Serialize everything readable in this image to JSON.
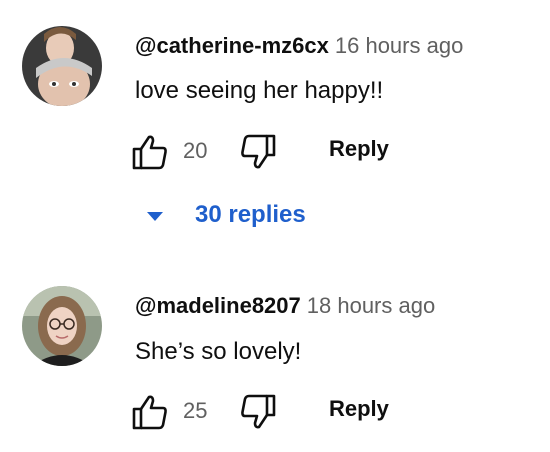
{
  "comments": [
    {
      "author": "@catherine-mz6cx",
      "time": "16 hours ago",
      "text": "love seeing her happy!!",
      "likes": "20",
      "reply_label": "Reply",
      "replies_label": "30 replies"
    },
    {
      "author": "@madeline8207",
      "time": "18 hours ago",
      "text": "She’s so lovely!",
      "likes": "25",
      "reply_label": "Reply"
    }
  ],
  "icons": {
    "like": "thumbs-up-icon",
    "dislike": "thumbs-down-icon",
    "expand": "caret-down-icon"
  },
  "colors": {
    "link": "#1f5fcc",
    "meta": "#606060",
    "text": "#0f0f0f"
  }
}
